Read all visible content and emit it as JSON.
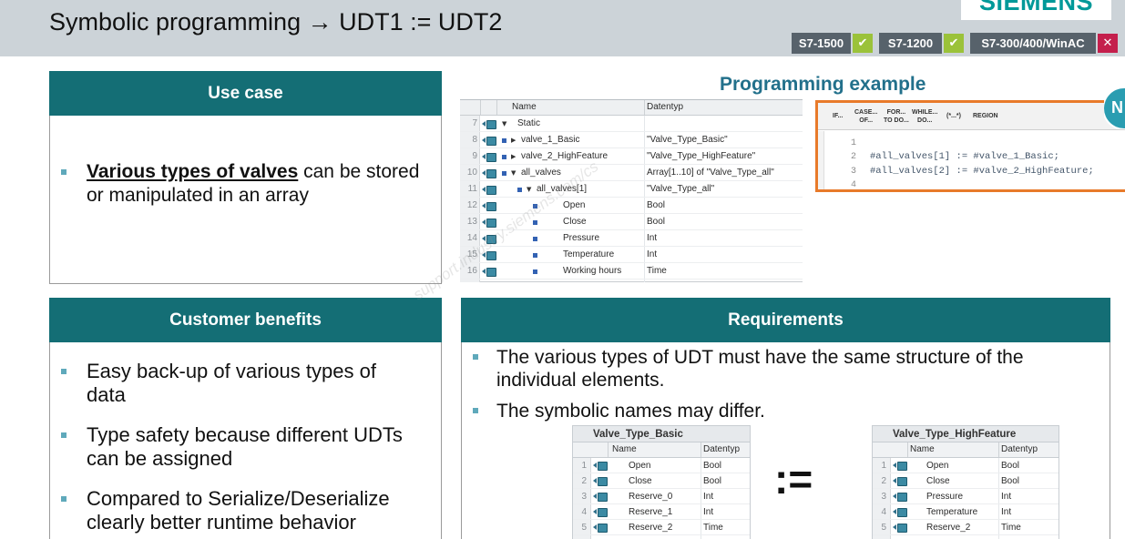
{
  "header": {
    "title": "Symbolic programming → UDT1 := UDT2",
    "logo_text": "SIEMENS"
  },
  "badges": [
    {
      "label": "S7-1500",
      "status_icon": "check-icon",
      "status_color": "#9bc23a"
    },
    {
      "label": "S7-1200",
      "status_icon": "check-icon",
      "status_color": "#9bc23a"
    },
    {
      "label": "S7-300/400/WinAC",
      "status_icon": "close-icon",
      "status_color": "#c41f4c"
    }
  ],
  "colors": {
    "section_header": "#146e75",
    "example_title": "#22708b",
    "editor_highlight": "#e87a2a",
    "bullet": "#5fa9bb",
    "header_band": "#ccd3d8"
  },
  "use_case": {
    "title": "Use case",
    "bullet_bold": "Various types of valves",
    "bullet_rest": " can be stored or manipulated in an array"
  },
  "benefits": {
    "title": "Customer benefits",
    "items": [
      "Easy back-up of various types of data",
      "Type safety because different UDTs can be assigned",
      "Compared to Serialize/Deserialize clearly better runtime behavior"
    ]
  },
  "example": {
    "title": "Programming example",
    "tia_table": {
      "columns": [
        "Name",
        "Datentyp"
      ],
      "rows": [
        {
          "num": "7",
          "level": 0,
          "marker": false,
          "expanded": true,
          "name": "Static",
          "type": ""
        },
        {
          "num": "8",
          "level": 0,
          "marker": true,
          "expanded": false,
          "name": "valve_1_Basic",
          "type": "\"Valve_Type_Basic\""
        },
        {
          "num": "9",
          "level": 0,
          "marker": true,
          "expanded": false,
          "name": "valve_2_HighFeature",
          "type": "\"Valve_Type_HighFeature\""
        },
        {
          "num": "10",
          "level": 0,
          "marker": true,
          "expanded": true,
          "name": "all_valves",
          "type": "Array[1..10] of \"Valve_Type_all\""
        },
        {
          "num": "11",
          "level": 1,
          "marker": true,
          "expanded": true,
          "name": "all_valves[1]",
          "type": "\"Valve_Type_all\""
        },
        {
          "num": "12",
          "level": 2,
          "marker": true,
          "expanded": null,
          "name": "Open",
          "type": "Bool"
        },
        {
          "num": "13",
          "level": 2,
          "marker": true,
          "expanded": null,
          "name": "Close",
          "type": "Bool"
        },
        {
          "num": "14",
          "level": 2,
          "marker": true,
          "expanded": null,
          "name": "Pressure",
          "type": "Int"
        },
        {
          "num": "15",
          "level": 2,
          "marker": true,
          "expanded": null,
          "name": "Temperature",
          "type": "Int"
        },
        {
          "num": "16",
          "level": 2,
          "marker": true,
          "expanded": null,
          "name": "Working hours",
          "type": "Time"
        }
      ]
    },
    "editor": {
      "toolbar": [
        {
          "line1": "IF...",
          "line2": ""
        },
        {
          "line1": "CASE...",
          "line2": "OF..."
        },
        {
          "line1": "FOR...",
          "line2": "TO DO..."
        },
        {
          "line1": "WHILE...",
          "line2": "DO..."
        },
        {
          "line1": "(*...*)",
          "line2": ""
        },
        {
          "line1": "REGION",
          "line2": ""
        }
      ],
      "lines": [
        {
          "num": "1",
          "code": ""
        },
        {
          "num": "2",
          "code": "#all_valves[1] := #valve_1_Basic;"
        },
        {
          "num": "3",
          "code": "#all_valves[2] := #valve_2_HighFeature;"
        },
        {
          "num": "4",
          "code": ""
        }
      ]
    },
    "new_badge": "N"
  },
  "requirements": {
    "title": "Requirements",
    "items": [
      "The various types of UDT must have the same structure of the individual elements.",
      "The symbolic names may differ."
    ],
    "assign_operator": ":=",
    "left_table": {
      "title": "Valve_Type_Basic",
      "columns": [
        "Name",
        "Datentyp"
      ],
      "rows": [
        {
          "num": "1",
          "name": "Open",
          "type": "Bool"
        },
        {
          "num": "2",
          "name": "Close",
          "type": "Bool"
        },
        {
          "num": "3",
          "name": "Reserve_0",
          "type": "Int"
        },
        {
          "num": "4",
          "name": "Reserve_1",
          "type": "Int"
        },
        {
          "num": "5",
          "name": "Reserve_2",
          "type": "Time"
        }
      ]
    },
    "right_table": {
      "title": "Valve_Type_HighFeature",
      "columns": [
        "Name",
        "Datentyp"
      ],
      "rows": [
        {
          "num": "1",
          "name": "Open",
          "type": "Bool"
        },
        {
          "num": "2",
          "name": "Close",
          "type": "Bool"
        },
        {
          "num": "3",
          "name": "Pressure",
          "type": "Int"
        },
        {
          "num": "4",
          "name": "Temperature",
          "type": "Int"
        },
        {
          "num": "5",
          "name": "Reserve_2",
          "type": "Time"
        }
      ]
    }
  },
  "watermark": {
    "text_cn": "西门子工业",
    "url": "support.industry.siemens.com/cs"
  }
}
